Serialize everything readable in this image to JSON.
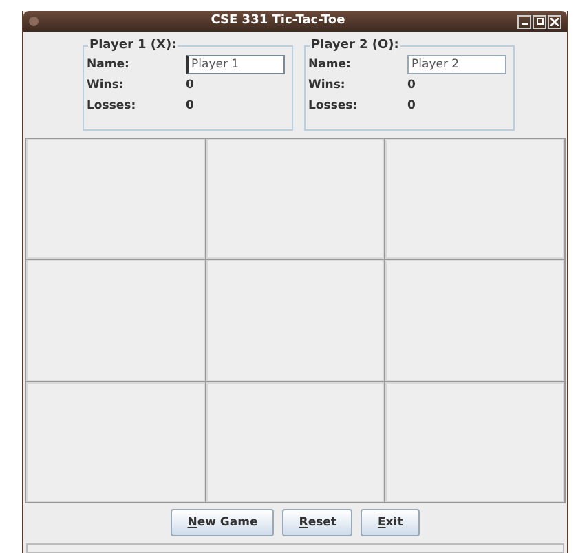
{
  "window": {
    "title": "CSE 331 Tic-Tac-Toe"
  },
  "players": [
    {
      "title": "Player 1 (X):",
      "name_label": "Name:",
      "name_value": "Player 1",
      "focused": true,
      "wins_label": "Wins:",
      "wins": "0",
      "losses_label": "Losses:",
      "losses": "0"
    },
    {
      "title": "Player 2 (O):",
      "name_label": "Name:",
      "name_value": "Player 2",
      "focused": false,
      "wins_label": "Wins:",
      "wins": "0",
      "losses_label": "Losses:",
      "losses": "0"
    }
  ],
  "board": {
    "cells": [
      {
        "kind": "empty"
      },
      {
        "kind": "empty"
      },
      {
        "kind": "empty"
      },
      {
        "kind": "empty"
      },
      {
        "kind": "empty"
      },
      {
        "kind": "empty"
      },
      {
        "kind": "empty"
      },
      {
        "kind": "empty"
      },
      {
        "kind": "empty"
      }
    ]
  },
  "buttons": [
    {
      "mnemonic": "N",
      "rest": "ew Game"
    },
    {
      "mnemonic": "R",
      "rest": "eset"
    },
    {
      "mnemonic": "E",
      "rest": "xit"
    }
  ]
}
